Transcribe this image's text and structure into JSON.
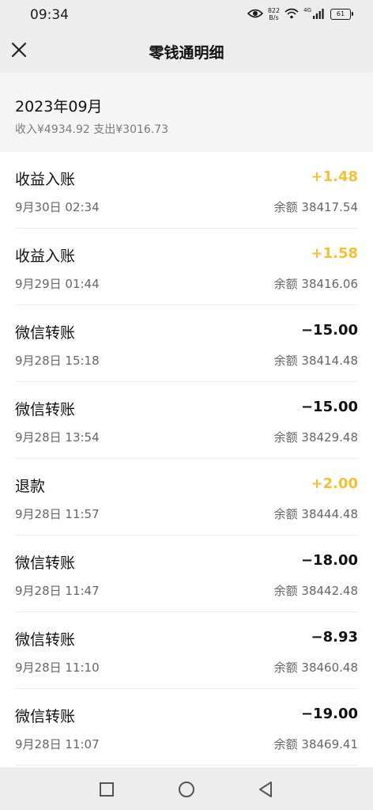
{
  "status_bar": {
    "time": "09:34",
    "net_speed_value": "822",
    "net_speed_unit": "B/s",
    "network_label": "4G",
    "battery": "61"
  },
  "header": {
    "title": "零钱通明细",
    "close_icon": "close-icon"
  },
  "summary": {
    "month": "2023年09月",
    "totals": "收入¥4934.92 支出¥3016.73"
  },
  "colors": {
    "income": "#f2c233",
    "expense": "#111111"
  },
  "transactions": [
    {
      "title": "收益入账",
      "amount": "+1.48",
      "date": "9月30日 02:34",
      "balance": "余额 38417.54",
      "type": "income"
    },
    {
      "title": "收益入账",
      "amount": "+1.58",
      "date": "9月29日 01:44",
      "balance": "余额 38416.06",
      "type": "income"
    },
    {
      "title": "微信转账",
      "amount": "−15.00",
      "date": "9月28日 15:18",
      "balance": "余额 38414.48",
      "type": "expense"
    },
    {
      "title": "微信转账",
      "amount": "−15.00",
      "date": "9月28日 13:54",
      "balance": "余额 38429.48",
      "type": "expense"
    },
    {
      "title": "退款",
      "amount": "+2.00",
      "date": "9月28日 11:57",
      "balance": "余额 38444.48",
      "type": "income"
    },
    {
      "title": "微信转账",
      "amount": "−18.00",
      "date": "9月28日 11:47",
      "balance": "余额 38442.48",
      "type": "expense"
    },
    {
      "title": "微信转账",
      "amount": "−8.93",
      "date": "9月28日 11:10",
      "balance": "余额 38460.48",
      "type": "expense"
    },
    {
      "title": "微信转账",
      "amount": "−19.00",
      "date": "9月28日 11:07",
      "balance": "余额 38469.41",
      "type": "expense"
    }
  ],
  "android_nav": {
    "recents_icon": "square-icon",
    "home_icon": "circle-icon",
    "back_icon": "triangle-back-icon"
  }
}
